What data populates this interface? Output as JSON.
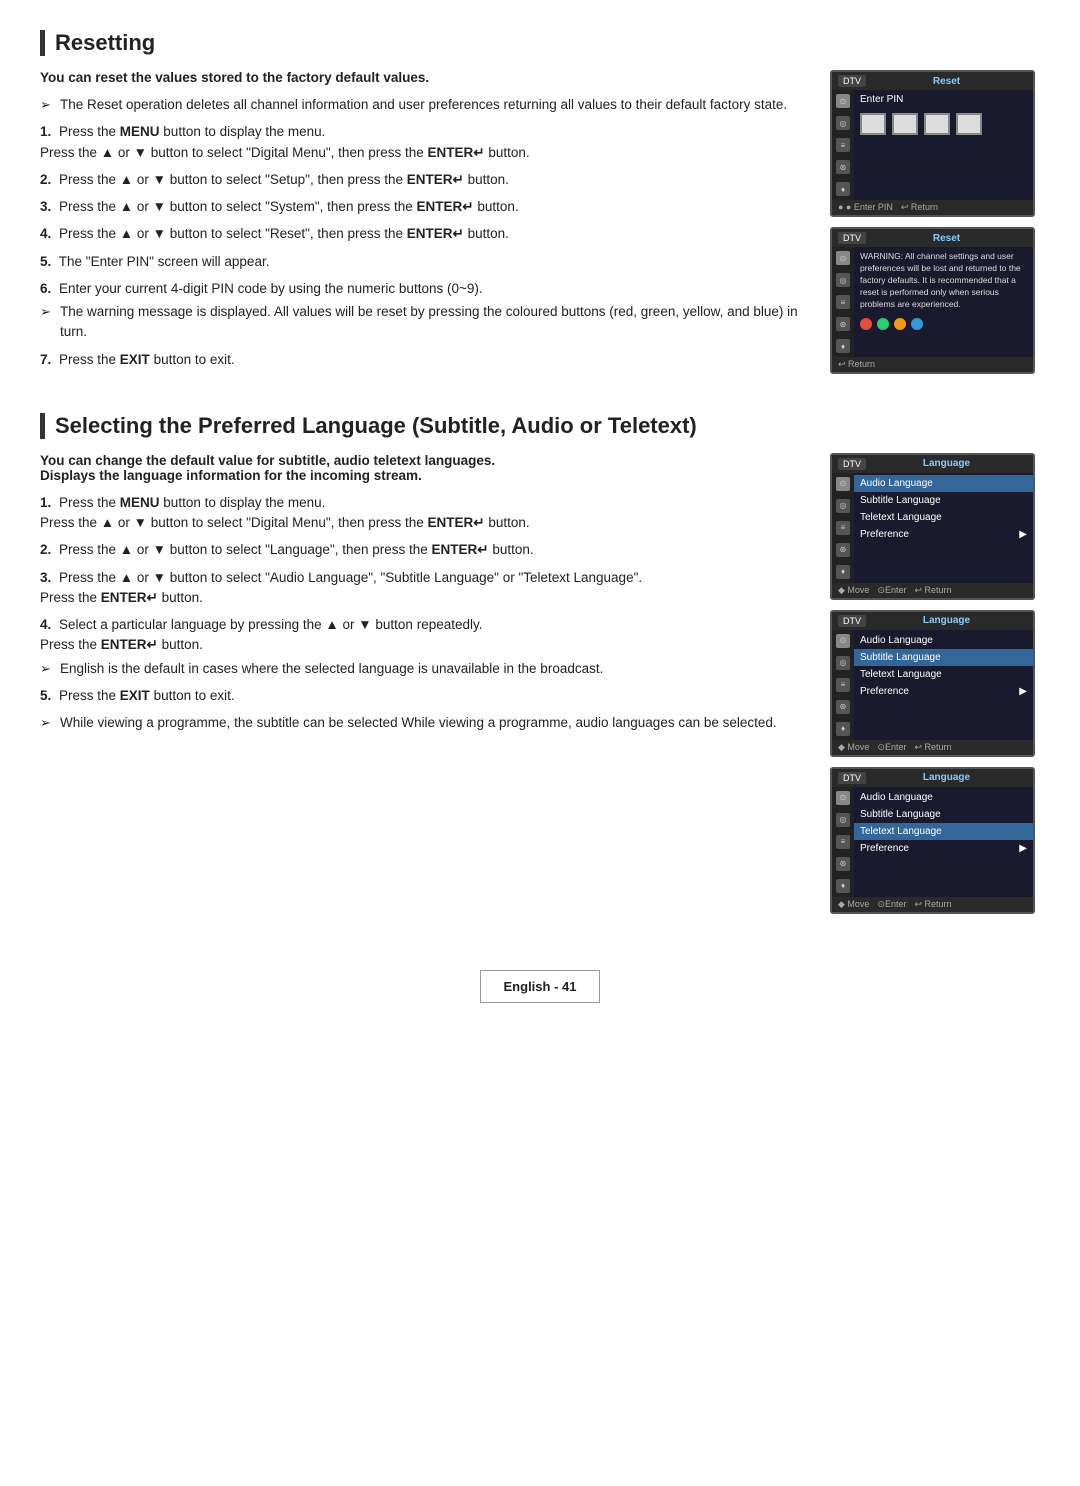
{
  "resetting": {
    "title": "Resetting",
    "intro_bold": "You can reset the values stored to the factory default values.",
    "steps": [
      {
        "type": "arrow",
        "text": "The Reset operation deletes all channel information and user preferences returning all values to their default factory state."
      },
      {
        "num": "1.",
        "text": "Press the ",
        "bold_word": "MENU",
        "text2": " button to display the menu.",
        "sub": "Press the ▲ or ▼ button to select \"Digital Menu\", then press the ",
        "bold_sub": "ENTER",
        "text3": " button."
      },
      {
        "num": "2.",
        "text": "Press the ▲ or ▼ button to select \"Setup\", then press the ",
        "bold_word": "ENTER",
        "text2": " button."
      },
      {
        "num": "3.",
        "text": "Press the ▲ or ▼ button to select \"System\", then press the ",
        "bold_word": "ENTER",
        "text2": " button."
      },
      {
        "num": "4.",
        "text": "Press the ▲ or ▼ button to select \"Reset\", then press the ",
        "bold_word": "ENTER",
        "text2": " button."
      },
      {
        "num": "5.",
        "text": "The \"Enter PIN\" screen will appear."
      },
      {
        "num": "6.",
        "text": "Enter your current 4-digit PIN code by using the numeric buttons (0~9).",
        "sub_arrow": "The warning message is displayed. All values will be reset by pressing the coloured buttons (red, green, yellow, and blue) in turn."
      },
      {
        "num": "7.",
        "text": "Press the ",
        "bold_word": "EXIT",
        "text2": " button to exit."
      }
    ],
    "screens": [
      {
        "id": "reset_pin",
        "dtv": "DTV",
        "title": "Reset",
        "enter_pin": "Enter PIN",
        "footer_items": [
          "● ● Enter PIN",
          "↩ Return"
        ]
      },
      {
        "id": "reset_warning",
        "dtv": "DTV",
        "title": "Reset",
        "warning": "WARNING: All channel settings and user preferences will be lost and returned to the factory defaults. It is recommended that a reset is performed only when serious problems are experienced.",
        "footer_items": [
          "↩ Return"
        ]
      }
    ]
  },
  "language": {
    "title": "Selecting the Preferred Language (Subtitle, Audio or Teletext)",
    "intro_bold": "You can change the default value for subtitle, audio teletext languages.",
    "intro_bold2": "Displays the language information for the incoming stream.",
    "steps": [
      {
        "num": "1.",
        "text": "Press the ",
        "bold_word": "MENU",
        "text2": " button to display the menu.",
        "sub": "Press the ▲ or ▼ button to select \"Digital Menu\", then press the ",
        "bold_sub": "ENTER",
        "text3": " button."
      },
      {
        "num": "2.",
        "text": "Press the ▲ or ▼ button to select \"Language\", then press the ",
        "bold_word": "ENTER",
        "text2": " button."
      },
      {
        "num": "3.",
        "text": "Press the ▲ or ▼ button to select \"Audio Language\", \"Subtitle Language\" or \"Teletext Language\".",
        "sub": "Press the ",
        "bold_sub": "ENTER",
        "text3": " button."
      },
      {
        "num": "4.",
        "text": "Select a particular language by pressing the ▲ or ▼ button repeatedly.",
        "sub": "Press the ",
        "bold_sub": "ENTER",
        "text3": " button.",
        "sub_arrow": "English is the default in cases where the selected language is unavailable in the broadcast."
      },
      {
        "num": "5.",
        "text": "Press the ",
        "bold_word": "EXIT",
        "text2": " button to exit."
      },
      {
        "type": "arrow",
        "text": "While viewing a programme, the subtitle can be selected While viewing a programme, audio languages can be selected."
      }
    ],
    "screens": [
      {
        "id": "lang_audio",
        "dtv": "DTV",
        "title": "Language",
        "items": [
          "Audio Language",
          "Subtitle Language",
          "Teletext Language",
          "Preference"
        ],
        "selected": 0,
        "footer_items": [
          "◆ Move",
          "⊙Enter",
          "↩ Return"
        ]
      },
      {
        "id": "lang_subtitle",
        "dtv": "DTV",
        "title": "Language",
        "items": [
          "Audio Language",
          "Subtitle Language",
          "Teletext Language",
          "Preference"
        ],
        "selected": 1,
        "footer_items": [
          "◆ Move",
          "⊙Enter",
          "↩ Return"
        ]
      },
      {
        "id": "lang_teletext",
        "dtv": "DTV",
        "title": "Language",
        "items": [
          "Audio Language",
          "Subtitle Language",
          "Teletext Language",
          "Preference"
        ],
        "selected": 2,
        "footer_items": [
          "◆ Move",
          "⊙Enter",
          "↩ Return"
        ]
      }
    ]
  },
  "footer": {
    "text": "English - 41"
  }
}
